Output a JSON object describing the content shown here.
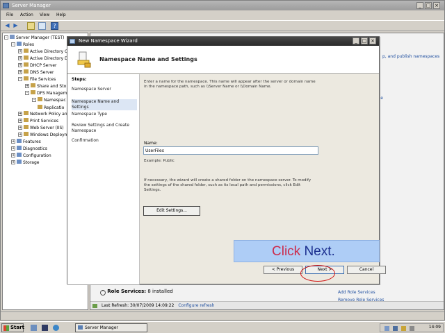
{
  "server_manager": {
    "title": "Server Manager",
    "menu": [
      "File",
      "Action",
      "View",
      "Help"
    ],
    "tree": [
      {
        "label": "Server Manager (TEST)",
        "indent": 0,
        "expander": "-"
      },
      {
        "label": "Roles",
        "indent": 1,
        "expander": "-"
      },
      {
        "label": "Active Directory Ce",
        "indent": 2,
        "expander": "+"
      },
      {
        "label": "Active Directory D",
        "indent": 2,
        "expander": "+"
      },
      {
        "label": "DHCP Server",
        "indent": 2,
        "expander": "+"
      },
      {
        "label": "DNS Server",
        "indent": 2,
        "expander": "+"
      },
      {
        "label": "File Services",
        "indent": 2,
        "expander": "-"
      },
      {
        "label": "Share and Sto",
        "indent": 3,
        "expander": "+"
      },
      {
        "label": "DFS Managem",
        "indent": 3,
        "expander": "-"
      },
      {
        "label": "Namespac",
        "indent": 4,
        "expander": "-"
      },
      {
        "label": "Replicatio",
        "indent": 4,
        "expander": ""
      },
      {
        "label": "Network Policy an",
        "indent": 2,
        "expander": "+"
      },
      {
        "label": "Print Services",
        "indent": 2,
        "expander": "+"
      },
      {
        "label": "Web Server (IIS)",
        "indent": 2,
        "expander": "+"
      },
      {
        "label": "Windows Deploym",
        "indent": 2,
        "expander": "+"
      },
      {
        "label": "Features",
        "indent": 1,
        "expander": "+"
      },
      {
        "label": "Diagnostics",
        "indent": 1,
        "expander": "+"
      },
      {
        "label": "Configuration",
        "indent": 1,
        "expander": "+"
      },
      {
        "label": "Storage",
        "indent": 1,
        "expander": "+"
      }
    ],
    "right_pane": {
      "partial_link_top": "p, and publish namespaces",
      "partial_link_2": "ce",
      "role_services_title": "Role Services:",
      "role_services_count": "8 installed",
      "add_role_services": "Add Role Services",
      "remove_role_services": "Remove Role Services",
      "last_refresh": "Last Refresh: 30/07/2009 14:09:22",
      "configure_refresh": "Configure refresh"
    }
  },
  "wizard": {
    "title": "New Namespace Wizard",
    "header_title": "Namespace Name and Settings",
    "steps_title": "Steps:",
    "steps": [
      {
        "label": "Namespace Server",
        "active": false
      },
      {
        "label": "Namespace Name and Settings",
        "active": true
      },
      {
        "label": "Namespace Type",
        "active": false
      },
      {
        "label": "Review Settings and Create Namespace",
        "active": false
      },
      {
        "label": "Confirmation",
        "active": false
      }
    ],
    "intro_text": "Enter a name for the namespace. This name will appear after the server or domain name in the namespace path, such as \\\\Server Name or \\\\Domain Name.",
    "name_label": "Name:",
    "name_value": "UserFiles",
    "example_text": "Example: Public",
    "settings_text": "If necessary, the wizard will create a shared folder on the namespace server. To modify the settings of the shared folder, such as its local path and permissions, click Edit Settings.",
    "edit_settings_label": "Edit Settings...",
    "buttons": {
      "previous": "< Previous",
      "next": "Next >",
      "cancel": "Cancel"
    }
  },
  "callout": {
    "word1": "Click",
    "word2": "Next."
  },
  "taskbar": {
    "start_label": "Start",
    "task_label": "Server Manager",
    "clock": "14:09"
  },
  "colors": {
    "callout_bg": "#aecdf6",
    "callout_click": "#cc2b4b",
    "callout_next": "#1b2f8f",
    "highlight_ring": "#d01515",
    "link": "#2150a0"
  }
}
